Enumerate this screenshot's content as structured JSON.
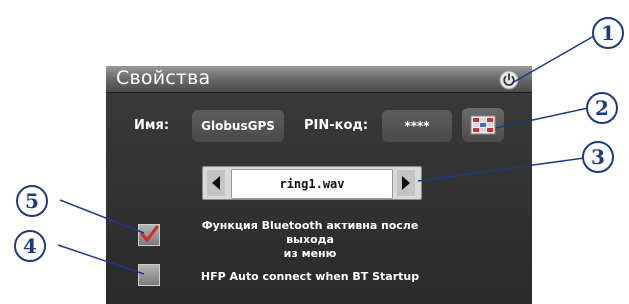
{
  "dialog": {
    "title": "Свойства",
    "name_label": "Имя:",
    "name_value": "GlobusGPS",
    "pin_label": "PIN-код:",
    "pin_value": "****",
    "ringtone_value": "ring1.wav",
    "bt_after_exit_label_line1": "Функция Bluetooth активна после выхода",
    "bt_after_exit_label_line2": "из меню",
    "bt_after_exit_checked": true,
    "hfp_auto_label": "HFP Auto connect when BT Startup",
    "hfp_auto_checked": false
  },
  "callouts": [
    "1",
    "2",
    "3",
    "4",
    "5"
  ],
  "icons": {
    "power": "power-icon",
    "keyboard": "keyboard-icon",
    "prev": "arrow-left-icon",
    "next": "arrow-right-icon",
    "check": "check-icon"
  },
  "colors": {
    "callout": "#1c3a86",
    "panel": "#333333",
    "check": "#d42a2a"
  }
}
